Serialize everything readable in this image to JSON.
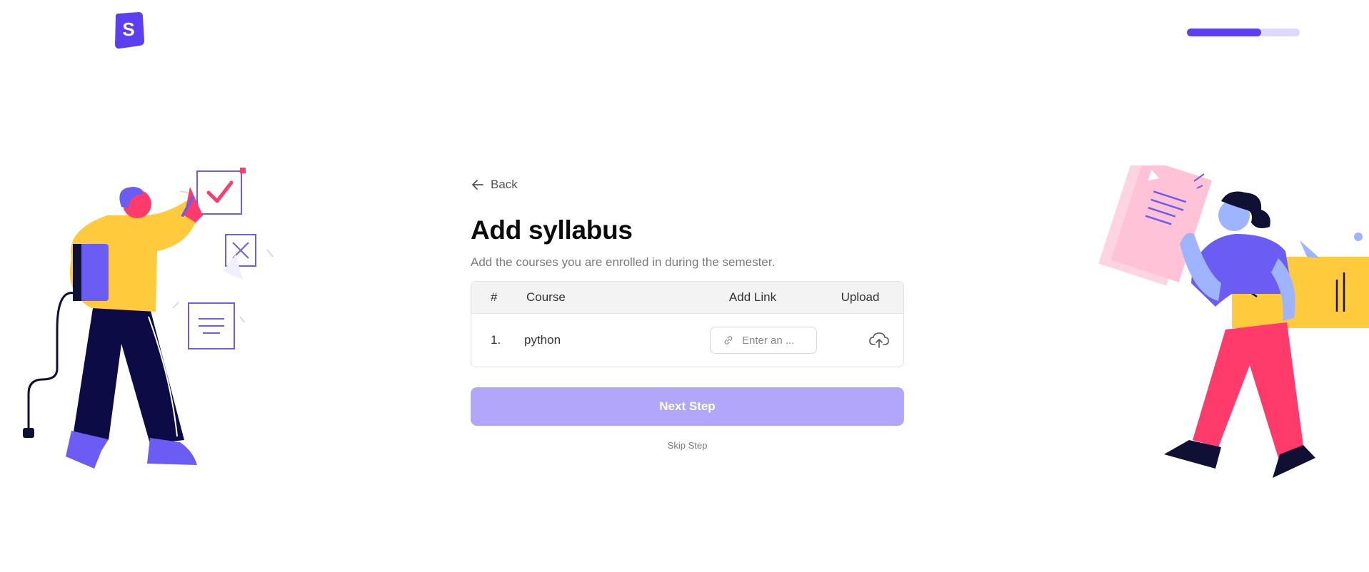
{
  "brand": {
    "logo_letter": "S",
    "color": "#5b3ff0"
  },
  "progress": {
    "fraction": 0.66,
    "fill_color": "#5b3ff0",
    "track_color": "#ddd9fb"
  },
  "nav": {
    "back_label": "Back"
  },
  "page": {
    "title": "Add syllabus",
    "subtitle": "Add the courses you are enrolled in during the semester."
  },
  "table": {
    "headers": {
      "num": "#",
      "course": "Course",
      "link": "Add Link",
      "upload": "Upload"
    },
    "rows": [
      {
        "num": "1.",
        "course": "python",
        "link_value": "",
        "link_placeholder": "Enter an ..."
      }
    ]
  },
  "actions": {
    "next_label": "Next Step",
    "skip_label": "Skip Step",
    "next_color": "#b1a6fa"
  },
  "icons": {
    "back": "arrow-left-icon",
    "link": "link-icon",
    "upload": "cloud-upload-icon"
  }
}
